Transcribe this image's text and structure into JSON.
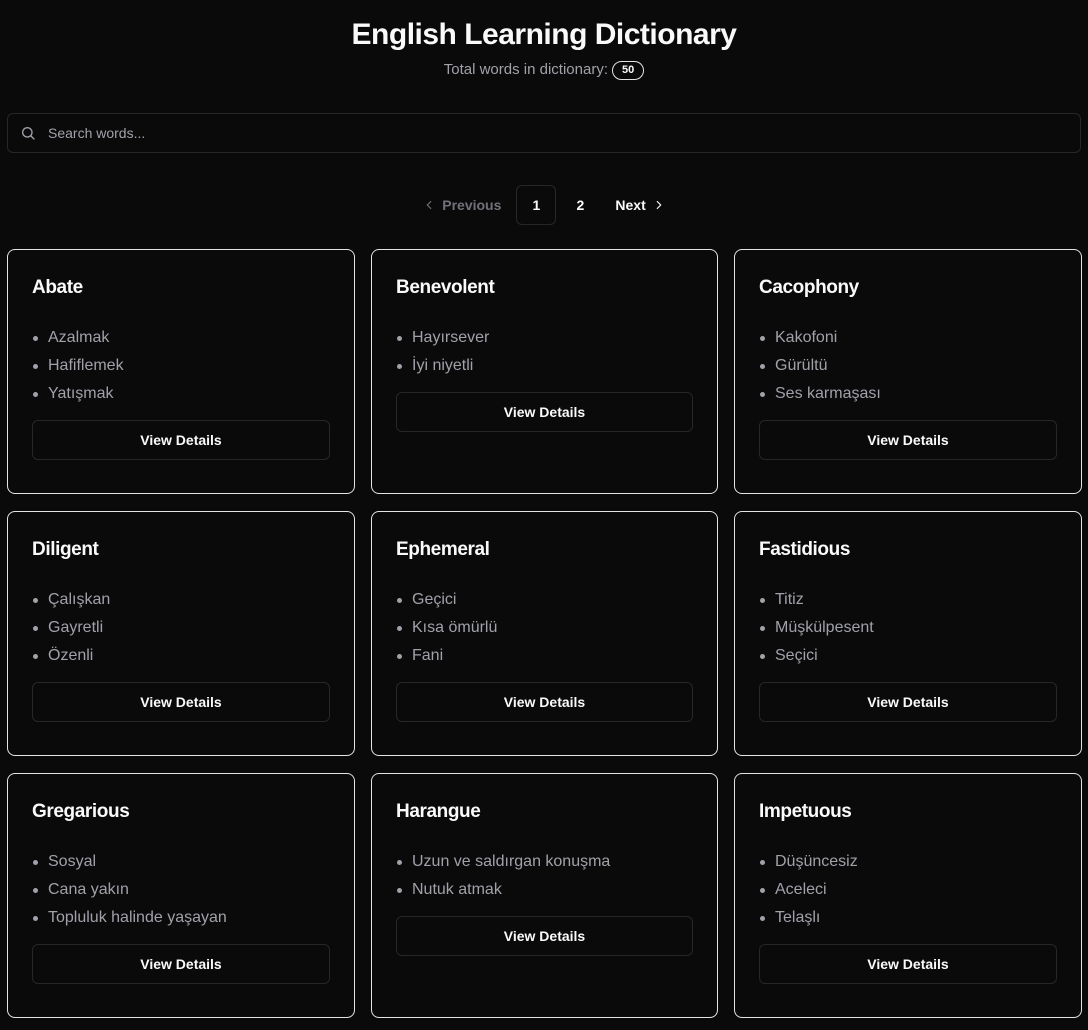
{
  "header": {
    "title": "English Learning Dictionary",
    "subtitle": "Total words in dictionary:",
    "word_count": "50"
  },
  "search": {
    "placeholder": "Search words...",
    "value": "",
    "icon": "search-icon"
  },
  "pagination": {
    "previous_label": "Previous",
    "next_label": "Next",
    "pages": [
      "1",
      "2"
    ],
    "current_page": "1"
  },
  "view_details_label": "View Details",
  "cards": [
    {
      "word": "Abate",
      "meanings": [
        "Azalmak",
        "Hafiflemek",
        "Yatışmak"
      ]
    },
    {
      "word": "Benevolent",
      "meanings": [
        "Hayırsever",
        "İyi niyetli"
      ]
    },
    {
      "word": "Cacophony",
      "meanings": [
        "Kakofoni",
        "Gürültü",
        "Ses karmaşası"
      ]
    },
    {
      "word": "Diligent",
      "meanings": [
        "Çalışkan",
        "Gayretli",
        "Özenli"
      ]
    },
    {
      "word": "Ephemeral",
      "meanings": [
        "Geçici",
        "Kısa ömürlü",
        "Fani"
      ]
    },
    {
      "word": "Fastidious",
      "meanings": [
        "Titiz",
        "Müşkülpesent",
        "Seçici"
      ]
    },
    {
      "word": "Gregarious",
      "meanings": [
        "Sosyal",
        "Cana yakın",
        "Topluluk halinde yaşayan"
      ]
    },
    {
      "word": "Harangue",
      "meanings": [
        "Uzun ve saldırgan konuşma",
        "Nutuk atmak"
      ]
    },
    {
      "word": "Impetuous",
      "meanings": [
        "Düşüncesiz",
        "Aceleci",
        "Telaşlı"
      ]
    }
  ],
  "colors": {
    "background": "#0a0a0a",
    "text": "#fafafa",
    "muted": "#a1a1aa",
    "border": "#27272a",
    "card_border": "#e4e4e7"
  }
}
